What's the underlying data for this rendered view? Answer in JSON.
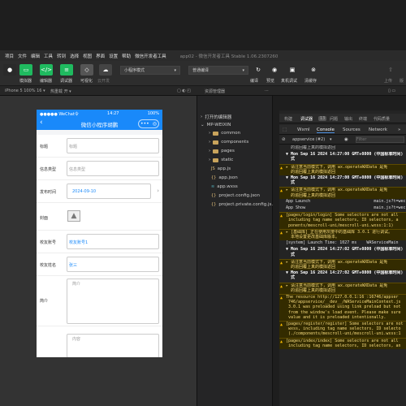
{
  "menu": {
    "items": [
      "项目",
      "文件",
      "编辑",
      "工具",
      "转到",
      "选择",
      "视图",
      "界面",
      "设置",
      "帮助",
      "微信开发者工具"
    ],
    "window_title": "app02 - 微信开发者工具 Stable 1.06.2307260"
  },
  "toolbar": {
    "buttons": [
      {
        "label": "模拟器",
        "color": "#1fba5f"
      },
      {
        "label": "编辑器",
        "color": "#1fba5f"
      },
      {
        "label": "调试器",
        "color": "#1fba5f"
      },
      {
        "label": "可视化",
        "color": "#555555"
      },
      {
        "label": "云开发",
        "color": "#444444"
      }
    ],
    "mode_select": "小程序模式",
    "compile_select": "普通编译",
    "right_labels": [
      "编译",
      "预览",
      "真机调试",
      "清缓存"
    ],
    "far_right_labels": [
      "上传",
      "版"
    ]
  },
  "subbar": {
    "device": "iPhone 5 100% 16 ▾",
    "hot_reload": "热重载 开 ▾",
    "explorer_title": "资源管理器"
  },
  "phone": {
    "status_left": "●●●●● WeChat令",
    "status_time": "14:27",
    "status_battery": "100%",
    "nav_title": "微信小程序胡鹏",
    "fields": [
      {
        "label": "标题",
        "value": "标题"
      },
      {
        "label": "信息类型",
        "value": "信息类型"
      },
      {
        "label": "发布时间",
        "value": "2024-09-10"
      },
      {
        "label": "封面",
        "value": ""
      },
      {
        "label": "校友账号",
        "value": "校友账号1"
      },
      {
        "label": "校友姓名",
        "value": "张三"
      },
      {
        "label": "简介",
        "value": "简介"
      },
      {
        "label": "",
        "value": "内容"
      }
    ]
  },
  "explorer": {
    "sections": [
      "打开的编辑器",
      "MP-WEIXIN"
    ],
    "items": [
      "common",
      "components",
      "pages",
      "static",
      "app.js",
      "app.json",
      "app.wxss",
      "project.config.json",
      "project.private.config.js..."
    ]
  },
  "debugger": {
    "top_tabs": [
      "构建",
      "调试器",
      "13",
      "问题",
      "输出",
      "终端",
      "代码质量"
    ],
    "console_tabs": [
      "Wxml",
      "Console",
      "Sources",
      "Network"
    ],
    "context": "appservice (#2)",
    "filter_placeholder": "Filter",
    "logs": [
      {
        "type": "gray",
        "text": "  的追回覆上真的模拟返回"
      },
      {
        "type": "date",
        "text": "▼ Mon Sep 16 2024 14:27:00 GMT+0800 (中国标准时间)\n  式"
      },
      {
        "type": "warn",
        "text": "▸ 请注意当前模式下，调用 wx.operateWXData 是免\n  的追回覆上真的模拟返回"
      },
      {
        "type": "date",
        "text": "▼ Mon Sep 16 2024 14:27:00 GMT+0800 (中国标准时间)\n  式"
      },
      {
        "type": "warn",
        "text": "▸ 请注意当前模式下，调用 wx.operateWXData 是免\n  的追回覆上真的模拟返回"
      },
      {
        "type": "plain",
        "text": "App Launch                          main.js?t=wec"
      },
      {
        "type": "plain",
        "text": "App Show                            main.js?t=wec"
      },
      {
        "type": "warn",
        "text": "[pages/login/login] Some selectors are not all\n including tag name selectors, ID selectors, a\n ponents/mescroll-uni/mescroll-uni.wxss:1:1)"
      },
      {
        "type": "warn",
        "text": "▸ [基础库] 正在使用灰度中的基础库 3.0.1 进行调试。\n  本地设置更改基础库版本。"
      },
      {
        "type": "plain",
        "text": "[system] Launch Time: 1027 ms    WAServiceMain"
      },
      {
        "type": "date",
        "text": "▼ Mon Sep 16 2024 14:27:02 GMT+0800 (中国标准时间)\n  式"
      },
      {
        "type": "warn",
        "text": "▸ 请注意当前模式下，调用 wx.operateWXData 是免\n  的追回覆上真的模拟返回"
      },
      {
        "type": "date",
        "text": "▼ Mon Sep 16 2024 14:27:02 GMT+0800 (中国标准时间)\n  式"
      },
      {
        "type": "warn",
        "text": "▸ 请注意当前模式下，调用 wx.operateWXData 是免\n  的追回覆上真的模拟返回"
      },
      {
        "type": "warn",
        "text": "The resource http://127.0.0.1:16 :16746/appser\n 746/appservice/__dev__/WAServiceMainContext.js\n 3.0.1 was preloaded using link preload but not\n from the window's load event. Please make sure\n value and it is preloaded intentionally."
      },
      {
        "type": "warn",
        "text": "[pages/register/register] Some selectors are not\n wxss, including tag name selectors, ID selecto\n (./components/mescroll-uni/mescroll-uni.wxss:1"
      },
      {
        "type": "warn",
        "text": "[pages/index/index] Some selectors are not all\n including tag name selectors, ID selectors, an"
      }
    ]
  }
}
